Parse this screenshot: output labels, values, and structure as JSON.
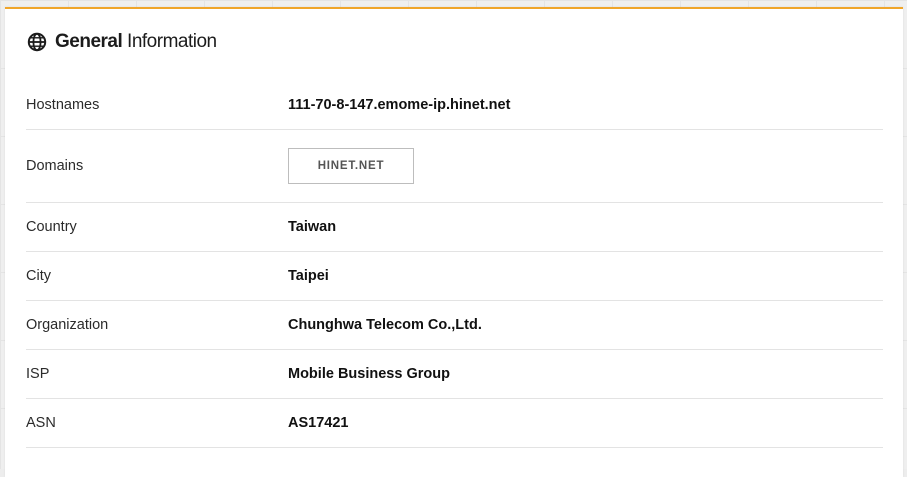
{
  "header": {
    "title_strong": "General",
    "title_light": "Information",
    "icon": "globe-icon",
    "accent_color": "#f0a52a"
  },
  "rows": [
    {
      "label": "Hostnames",
      "value": "111-70-8-147.emome-ip.hinet.net"
    },
    {
      "label": "Domains",
      "tag": "HINET.NET"
    },
    {
      "label": "Country",
      "value": "Taiwan"
    },
    {
      "label": "City",
      "value": "Taipei"
    },
    {
      "label": "Organization",
      "value": "Chunghwa Telecom Co.,Ltd."
    },
    {
      "label": "ISP",
      "value": "Mobile Business Group"
    },
    {
      "label": "ASN",
      "value": "AS17421"
    }
  ]
}
